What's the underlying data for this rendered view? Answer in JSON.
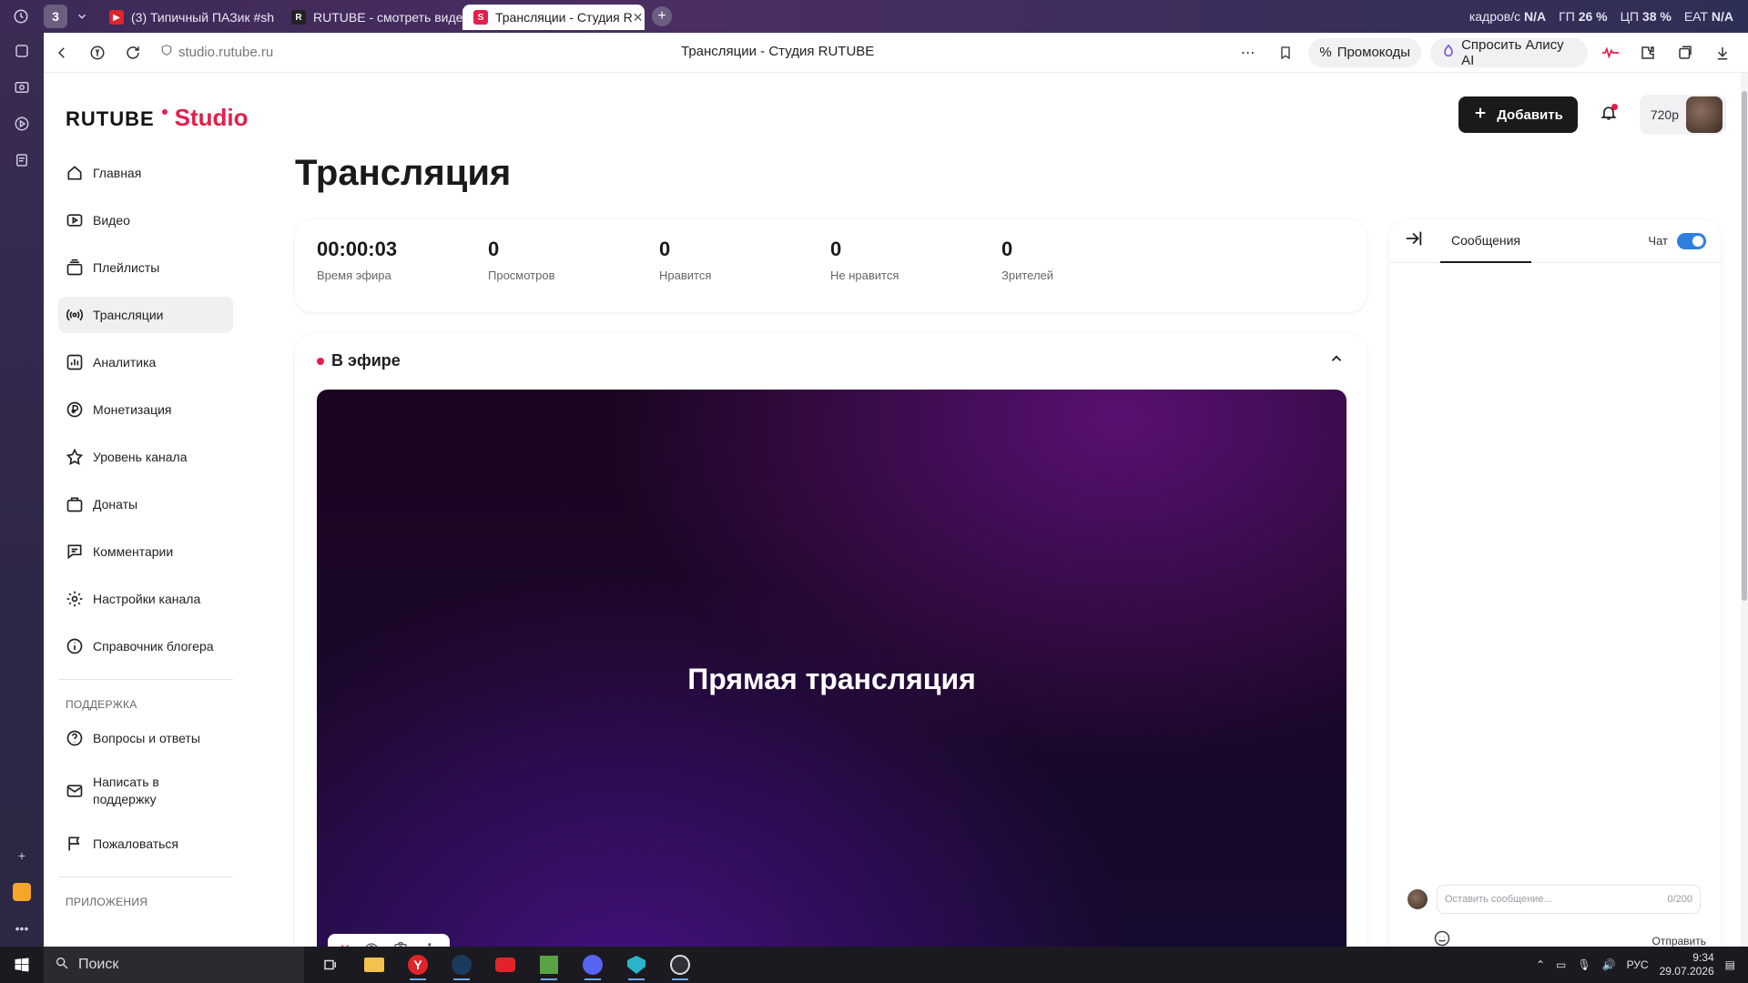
{
  "browser": {
    "tab_count": "3",
    "tabs": [
      {
        "label": "(3) Типичный ПАЗик #sh",
        "icon": "youtube-icon",
        "color": "#e0242a"
      },
      {
        "label": "RUTUBE - смотреть виде",
        "icon": "rutube-icon",
        "color": "#222222"
      },
      {
        "label": "Трансляции - Студия R",
        "icon": "rutube-studio-icon",
        "color": "#e51e4b"
      }
    ],
    "sys_stats": [
      {
        "label": "кадров/с",
        "value": "N/A"
      },
      {
        "label": "ГП",
        "value": "26 %"
      },
      {
        "label": "ЦП",
        "value": "38 %"
      },
      {
        "label": "ЕАТ",
        "value": "N/A"
      }
    ],
    "url": "studio.rutube.ru",
    "page_title": "Трансляции - Студия RUTUBE",
    "promo_label": "Промокоды",
    "alice_label": "Спросить Алису AI"
  },
  "app": {
    "logo_main": "RUTUBE",
    "logo_sub": "Studio",
    "add_button": "Добавить",
    "quality": "720p",
    "accent_color": "#e51e4b"
  },
  "sidebar": {
    "items": [
      {
        "label": "Главная",
        "icon": "home-icon"
      },
      {
        "label": "Видео",
        "icon": "video-icon"
      },
      {
        "label": "Плейлисты",
        "icon": "playlist-icon"
      },
      {
        "label": "Трансляции",
        "icon": "broadcast-icon",
        "active": true
      },
      {
        "label": "Аналитика",
        "icon": "analytics-icon"
      },
      {
        "label": "Монетизация",
        "icon": "monetization-icon"
      },
      {
        "label": "Уровень канала",
        "icon": "star-icon"
      },
      {
        "label": "Донаты",
        "icon": "donate-icon"
      },
      {
        "label": "Комментарии",
        "icon": "comment-icon"
      },
      {
        "label": "Настройки канала",
        "icon": "gear-icon"
      },
      {
        "label": "Справочник блогера",
        "icon": "info-icon"
      }
    ],
    "support_title": "ПОДДЕРЖКА",
    "support_items": [
      {
        "label": "Вопросы и ответы",
        "icon": "question-icon"
      },
      {
        "label": "Написать в поддержку",
        "icon": "mail-icon"
      },
      {
        "label": "Пожаловаться",
        "icon": "flag-icon"
      }
    ],
    "apps_title": "ПРИЛОЖЕНИЯ"
  },
  "main": {
    "title": "Трансляция",
    "stats": [
      {
        "value": "00:00:03",
        "label": "Время эфира"
      },
      {
        "value": "0",
        "label": "Просмотров"
      },
      {
        "value": "0",
        "label": "Нравится"
      },
      {
        "value": "0",
        "label": "Не нравится"
      },
      {
        "value": "0",
        "label": "Зрителей"
      }
    ],
    "live_label": "В эфире",
    "player_title": "Прямая трансляция"
  },
  "chat": {
    "tab_label": "Сообщения",
    "chat_label": "Чат",
    "chat_enabled": true,
    "placeholder": "Оставить сообщение...",
    "counter": "0/200",
    "send_label": "Отправить"
  },
  "taskbar": {
    "search_label": "Поиск",
    "lang": "РУС",
    "time": "9:34",
    "date": "29.07.2026"
  }
}
